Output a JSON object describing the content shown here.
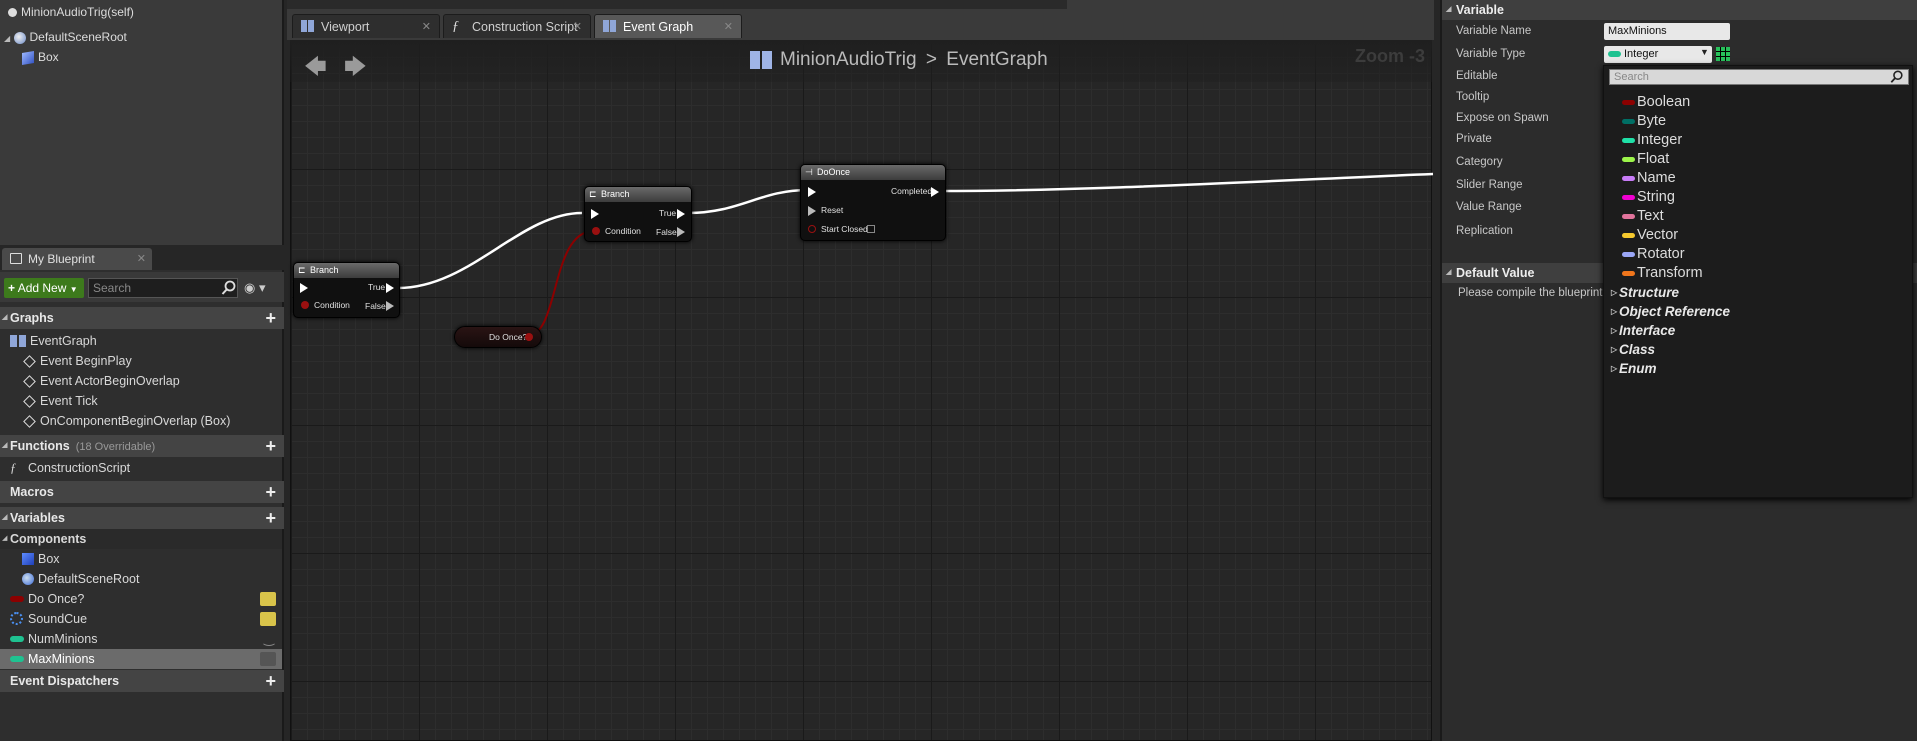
{
  "components": {
    "self_label": "MinionAudioTrig(self)",
    "root_label": "DefaultSceneRoot",
    "box_label": "Box"
  },
  "tabs": [
    {
      "label": "Viewport"
    },
    {
      "label": "Construction Script"
    },
    {
      "label": "Event Graph"
    }
  ],
  "breadcrumb": {
    "blueprint": "MinionAudioTrig",
    "separator": ">",
    "graph": "EventGraph"
  },
  "zoom_label": "Zoom -3",
  "my_blueprint": {
    "tab_label": "My Blueprint",
    "add_new_label": "Add New",
    "search_placeholder": "Search",
    "graphs_header": "Graphs",
    "graphs": [
      "EventGraph",
      "Event BeginPlay",
      "Event ActorBeginOverlap",
      "Event Tick",
      "OnComponentBeginOverlap (Box)"
    ],
    "functions_header": "Functions",
    "functions_sub": "(18 Overridable)",
    "functions": [
      "ConstructionScript"
    ],
    "macros_header": "Macros",
    "variables_header": "Variables",
    "components_header": "Components",
    "component_vars": [
      "Box",
      "DefaultSceneRoot"
    ],
    "variables": [
      "Do Once?",
      "SoundCue",
      "NumMinions",
      "MaxMinions"
    ],
    "dispatchers_header": "Event Dispatchers"
  },
  "nodes": {
    "branch1": {
      "title": "Branch",
      "true": "True",
      "false": "False",
      "cond": "Condition"
    },
    "branch2": {
      "title": "Branch",
      "true": "True",
      "false": "False",
      "cond": "Condition"
    },
    "doonce": {
      "title": "DoOnce",
      "completed": "Completed",
      "reset": "Reset",
      "start_closed": "Start Closed"
    },
    "getvar": {
      "title": "Do Once?"
    }
  },
  "details": {
    "variable_header": "Variable",
    "rows": [
      "Variable Name",
      "Variable Type",
      "Editable",
      "Tooltip",
      "Expose on Spawn",
      "Private",
      "Category",
      "Slider Range",
      "Value Range",
      "Replication"
    ],
    "variable_name_value": "MaxMinions",
    "variable_type_value": "Integer",
    "default_header": "Default Value",
    "default_msg": "Please compile the blueprint"
  },
  "type_dropdown": {
    "search_placeholder": "Search",
    "types": [
      {
        "name": "Boolean",
        "color": "#8c0000"
      },
      {
        "name": "Byte",
        "color": "#006f65"
      },
      {
        "name": "Integer",
        "color": "#1fe0a7"
      },
      {
        "name": "Float",
        "color": "#9cf54a"
      },
      {
        "name": "Name",
        "color": "#c87cf7"
      },
      {
        "name": "String",
        "color": "#f000d0"
      },
      {
        "name": "Text",
        "color": "#e2749c"
      },
      {
        "name": "Vector",
        "color": "#f6c92e"
      },
      {
        "name": "Rotator",
        "color": "#9aa6f6"
      },
      {
        "name": "Transform",
        "color": "#f0761c"
      }
    ],
    "categories": [
      "Structure",
      "Object Reference",
      "Interface",
      "Class",
      "Enum"
    ]
  }
}
